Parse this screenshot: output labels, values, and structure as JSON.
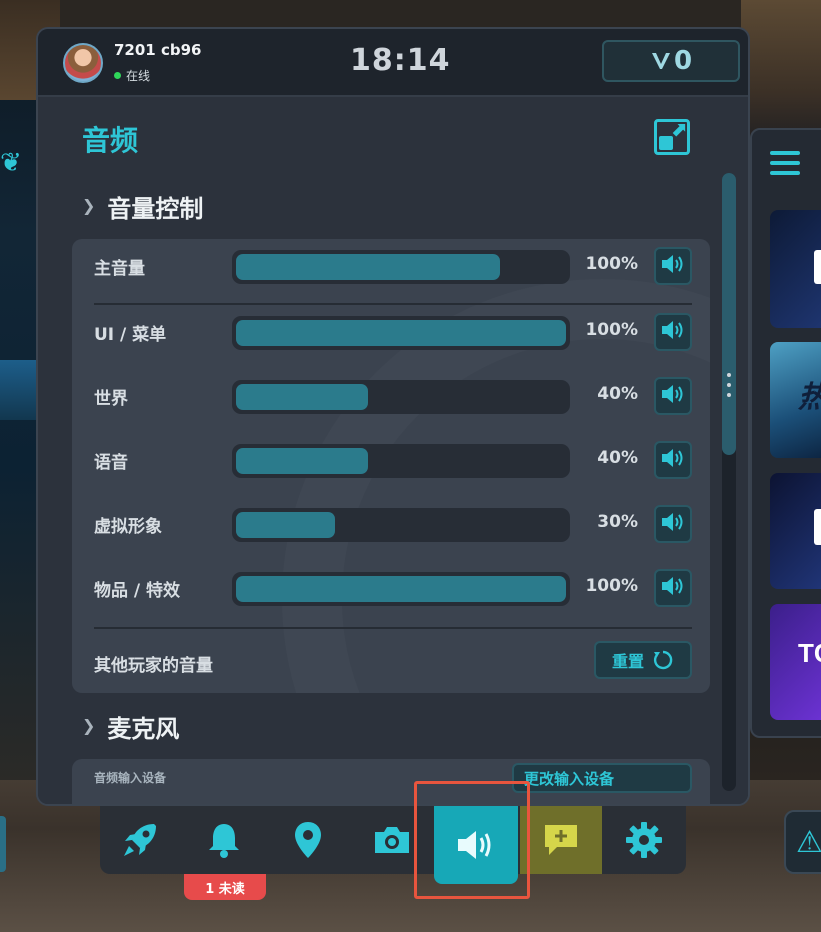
{
  "header": {
    "user_name": "7201 cb96",
    "status": "在线",
    "clock": "18:14",
    "currency_value": "0"
  },
  "page": {
    "title": "音频"
  },
  "volume_section": {
    "title": "音量控制",
    "rows": [
      {
        "label": "主音量",
        "value": "100%",
        "level": 0.8
      },
      {
        "label": "UI / 菜单",
        "value": "100%",
        "level": 1.0
      },
      {
        "label": "世界",
        "value": "40%",
        "level": 0.4
      },
      {
        "label": "语音",
        "value": "40%",
        "level": 0.4
      },
      {
        "label": "虚拟形象",
        "value": "30%",
        "level": 0.3
      },
      {
        "label": "物品 / 特效",
        "value": "100%",
        "level": 1.0
      }
    ],
    "others_label": "其他玩家的音量",
    "reset_label": "重置"
  },
  "mic_section": {
    "title": "麦克风",
    "input_device_label": "音频输入设备",
    "input_device_value": "更改输入设备"
  },
  "toolbar": {
    "items": [
      {
        "name": "launch",
        "icon": "rocket-icon"
      },
      {
        "name": "notifications",
        "icon": "bell-icon"
      },
      {
        "name": "location",
        "icon": "map-pin-icon"
      },
      {
        "name": "camera",
        "icon": "camera-icon"
      },
      {
        "name": "audio",
        "icon": "speaker-icon"
      },
      {
        "name": "emote",
        "icon": "chat-plus-icon"
      },
      {
        "name": "settings",
        "icon": "gear-icon"
      }
    ],
    "notification_badge": "1 未读"
  },
  "side_panel": {
    "card2_text": "热",
    "card4_text": "TC"
  },
  "colors": {
    "accent": "#2ec6d6",
    "slider_fill": "#2b7b8c",
    "badge": "#e74b4b",
    "highlight": "#e8553e"
  }
}
